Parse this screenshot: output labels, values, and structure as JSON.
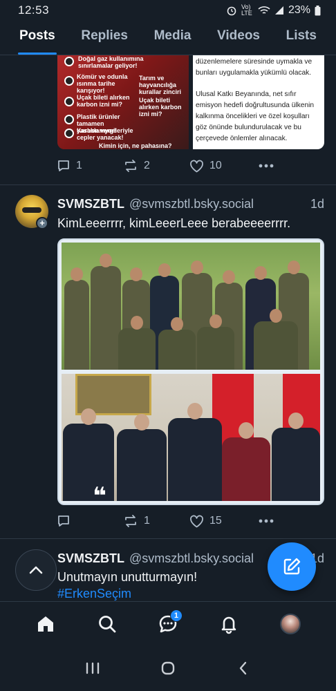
{
  "status_bar": {
    "time": "12:53",
    "network": "Vo) LTE",
    "battery": "23%"
  },
  "tabs": [
    {
      "label": "Posts",
      "active": true
    },
    {
      "label": "Replies",
      "active": false
    },
    {
      "label": "Media",
      "active": false
    },
    {
      "label": "Videos",
      "active": false
    },
    {
      "label": "Lists",
      "active": false
    }
  ],
  "post1": {
    "image_left_lines": [
      "Doğal gaz kullanımına sınırlamalar geliyor!",
      "Kömür ve odunla ısınma tarihe karışıyor!",
      "Uçak bileti alırken karbon izni mi?",
      "Plastik ürünler tamamen yasaklanıyor!",
      "Karbon vergileriyle cepler yanacak!",
      "Kimin için, ne pahasına?",
      "Tarım ve hayvancılığa kurallar zinciri",
      "Uçak bileti alırken karbon izni mi?"
    ],
    "image_right_para1": "düzenlemelere süresinde uymakla ve bunları uygulamakla yükümlü olacak.",
    "image_right_para2": "Ulusal Katkı Beyanında, net sıfır emisyon hedefi doğrultusunda ülkenin kalkınma öncelikleri ve özel koşulları göz önünde bulundurulacak ve bu çerçevede önlemler alınacak.",
    "replies": "1",
    "reposts": "2",
    "likes": "10"
  },
  "post2": {
    "author": "SVMSZBTL",
    "handle": "@svmszbtl.bsky.social",
    "time": "1d",
    "text": "KimLeeerrrr, kimLeeerLeee berabeeeerrrr.",
    "quote_mark": "❝",
    "replies": "",
    "reposts": "1",
    "likes": "15"
  },
  "post3": {
    "author": "SVMSZBTL",
    "handle": "@svmszbtl.bsky.social",
    "time": "1d",
    "text": "Unutmayın unutturmayın!",
    "hashtag": "#ErkenSeçim"
  },
  "bottom_nav": {
    "chat_badge": "1"
  },
  "icons": {
    "home": "home-icon",
    "search": "search-icon",
    "chat": "chat-icon",
    "notifications": "bell-icon",
    "compose": "compose-icon",
    "scroll_top": "chevron-up-icon"
  },
  "colors": {
    "background": "#161e27",
    "accent": "#208bfe",
    "muted": "#aebbc9"
  }
}
